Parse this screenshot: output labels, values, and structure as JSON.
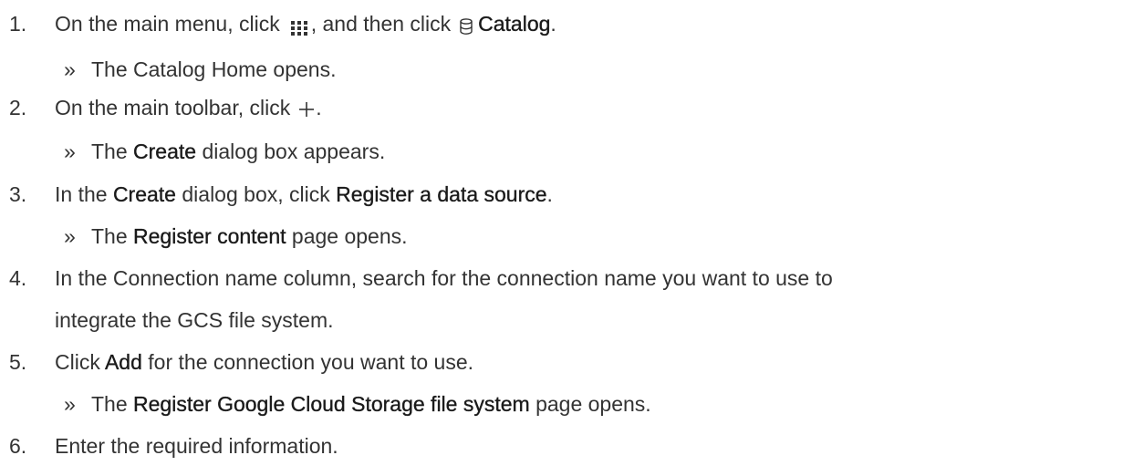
{
  "steps": [
    {
      "number": "1.",
      "parts": [
        "On the main menu, click",
        ", and then click",
        "Catalog",
        "."
      ],
      "icons": [
        "grid-icon",
        "database-icon"
      ],
      "result": {
        "marker": "»",
        "text": "The Catalog Home opens."
      }
    },
    {
      "number": "2.",
      "parts": [
        "On the main toolbar, click",
        "."
      ],
      "icons": [
        "plus-icon"
      ],
      "result": {
        "marker": "»",
        "pre": "The",
        "bold": "Create",
        "post": "dialog box appears."
      }
    },
    {
      "number": "3.",
      "parts": [
        "In the",
        "Create",
        "dialog box, click",
        "Register a data source",
        "."
      ],
      "result": {
        "marker": "»",
        "pre": "The",
        "bold": "Register content",
        "post": "page opens."
      }
    },
    {
      "number": "4.",
      "line1": "In the Connection name column, search for the connection name you want to use to",
      "line2": "integrate the GCS file system."
    },
    {
      "number": "5.",
      "parts": [
        "Click",
        "Add",
        "for the connection you want to use."
      ],
      "result": {
        "marker": "»",
        "pre": "The",
        "bold": "Register Google Cloud Storage file system",
        "post": "page opens."
      }
    },
    {
      "number": "6.",
      "text": "Enter the required information."
    }
  ]
}
